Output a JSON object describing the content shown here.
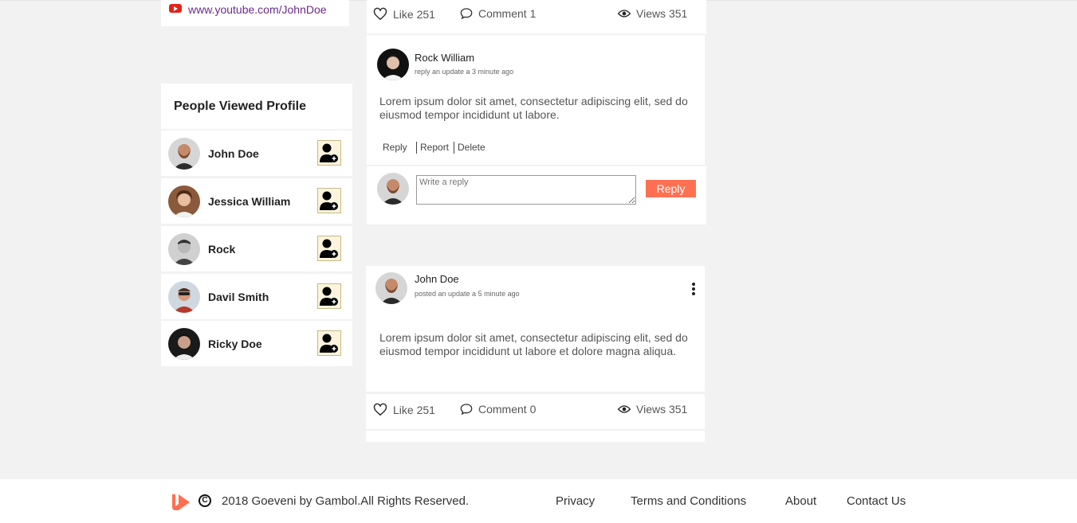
{
  "social": {
    "icon": "youtube-icon",
    "youtube_link": "www.youtube.com/JohnDoe"
  },
  "people_viewed": {
    "title": "People Viewed Profile",
    "people": [
      {
        "name": "John Doe"
      },
      {
        "name": "Jessica William"
      },
      {
        "name": "Rock"
      },
      {
        "name": "Davil Smith"
      },
      {
        "name": "Ricky Doe"
      }
    ]
  },
  "post1": {
    "like": "Like 251",
    "comment": "Comment 1",
    "views": "Views 351"
  },
  "comment1": {
    "author": "Rock William",
    "subtitle": "reply an update a 3 minute ago",
    "text": "Lorem ipsum dolor sit amet, consectetur adipiscing elit, sed do eiusmod tempor incididunt ut labore.",
    "actions": {
      "reply": "Reply",
      "report": "Report",
      "delete": "Delete"
    }
  },
  "reply_box": {
    "placeholder": "Write a reply",
    "button": "Reply"
  },
  "post2": {
    "author": "John Doe",
    "subtitle": "posted an update a 5 minute ago",
    "text": "Lorem ipsum dolor sit amet, consectetur adipiscing elit, sed do eiusmod tempor incididunt ut labore et dolore magna aliqua.",
    "like": "Like 251",
    "comment": "Comment 0",
    "views": "Views 351"
  },
  "footer": {
    "copyright_symbol": "C",
    "copyright": "2018 Goeveni by Gambol.All Rights Reserved.",
    "links": {
      "privacy": "Privacy",
      "terms": "Terms and Conditions",
      "about": "About",
      "contact": "Contact Us"
    }
  },
  "colors": {
    "accent": "#ff7052",
    "background": "#f2f2f2",
    "link": "#6a2a8a",
    "youtube": "#e62117"
  }
}
